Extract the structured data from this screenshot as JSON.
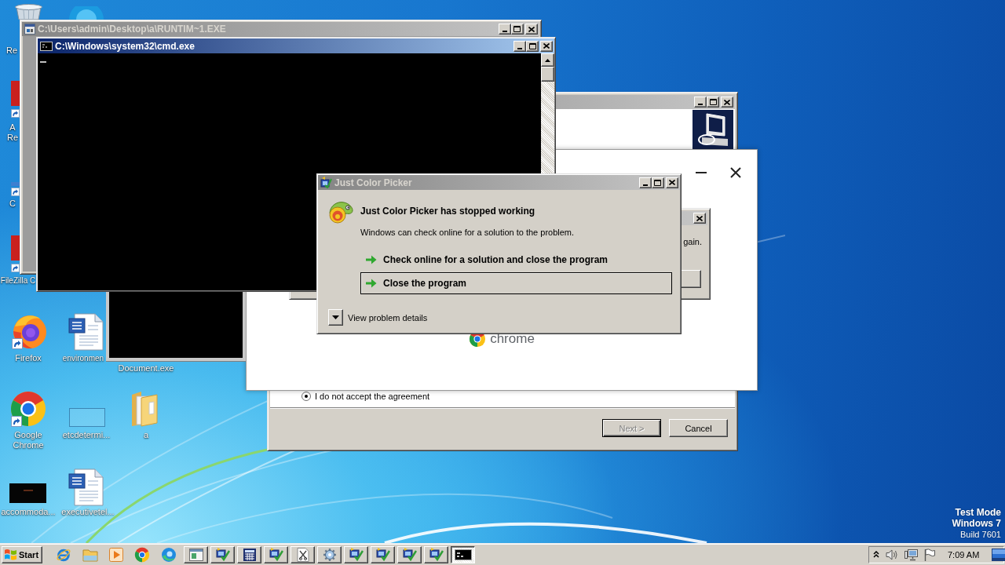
{
  "desktop": {
    "icons": [
      {
        "kind": "recycle_bin",
        "lines": [
          "Re"
        ]
      },
      {
        "kind": "round_app"
      },
      {
        "kind": "red_app",
        "lines": [
          "A",
          "Re"
        ]
      },
      {
        "kind": "shortcut",
        "lines": [
          "C"
        ]
      },
      {
        "kind": "red_app",
        "lines": [
          "FileZilla C"
        ]
      },
      {
        "kind": "firefox",
        "lines": [
          "Firefox"
        ]
      },
      {
        "kind": "word_doc",
        "lines": [
          "environmen"
        ]
      },
      {
        "lines": [
          "Document.exe"
        ]
      },
      {
        "kind": "chrome",
        "lines": [
          "Google",
          "Chrome"
        ]
      },
      {
        "kind": "blank_file",
        "lines": [
          "etcdetermi..."
        ]
      },
      {
        "kind": "folder",
        "lines": [
          "a"
        ]
      },
      {
        "kind": "dark_file",
        "lines": [
          "accommoda..."
        ]
      },
      {
        "kind": "word_doc",
        "lines": [
          "executivetel..."
        ]
      }
    ],
    "notice": [
      {
        "text": "Test Mode",
        "bold": true
      },
      {
        "text": "Windows 7",
        "bold": true
      },
      {
        "text": "Build 7601",
        "bold": false
      }
    ]
  },
  "setup_window": {
    "active": false,
    "radio": {
      "label": "I do not accept the agreement",
      "selected": true
    },
    "buttons": [
      {
        "label": "Next >",
        "disabled": true,
        "default": true
      },
      {
        "label": "Cancel",
        "disabled": false,
        "default": false
      }
    ]
  },
  "installer_window": {
    "wordmark": "chrome"
  },
  "message_dialog": {
    "active": false,
    "text": "gain."
  },
  "runtime_console": {
    "title": "C:\\Users\\admin\\Desktop\\a\\RUNTIM~1.EXE",
    "active": false
  },
  "cmd_window": {
    "title": "C:\\Windows\\system32\\cmd.exe",
    "active": true
  },
  "error_dialog": {
    "title": "Just Color Picker",
    "active": false,
    "heading": "Just Color Picker has stopped working",
    "message": "Windows can check online for a solution to the problem.",
    "options": [
      {
        "label": "Check online for a solution and close the program",
        "selected": false
      },
      {
        "label": "Close the program",
        "selected": true
      }
    ],
    "details_toggle": {
      "label": "View problem details",
      "expanded": false
    }
  },
  "taskbar": {
    "start": "Start",
    "quick_launch": [
      {
        "kind": "ie"
      },
      {
        "kind": "explorer"
      },
      {
        "kind": "media"
      },
      {
        "kind": "chrome"
      },
      {
        "kind": "edge"
      }
    ],
    "tasks": [
      {
        "kind": "window",
        "selected": false
      },
      {
        "kind": "setup",
        "selected": false
      },
      {
        "kind": "grid",
        "selected": false
      },
      {
        "kind": "setup",
        "selected": false
      },
      {
        "kind": "tool",
        "selected": false
      },
      {
        "kind": "gear",
        "selected": false
      },
      {
        "kind": "setup",
        "selected": false
      },
      {
        "kind": "setup",
        "selected": false
      },
      {
        "kind": "setup",
        "selected": false
      },
      {
        "kind": "setup",
        "selected": false
      },
      {
        "kind": "console",
        "selected": true
      }
    ],
    "clock": "7:09 AM"
  }
}
